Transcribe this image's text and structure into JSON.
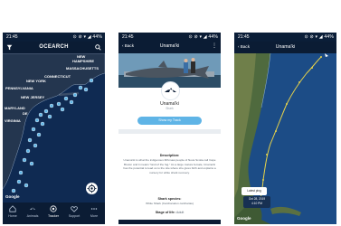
{
  "status": {
    "time": "21:45",
    "right": "⊙ ⊘ ▾ ◢ 44%"
  },
  "phone1": {
    "logo": "OCEARCH",
    "labels": [
      "NEW",
      "HAMPSHIRE",
      "MASSACHUSETTS",
      "CONNECTICUT",
      "NEW YORK",
      "PENNSYLVANIA",
      "NEW JERSEY",
      "MARYLAND",
      "VIRGINIA",
      "DE"
    ],
    "tabs": [
      {
        "label": "Home",
        "icon": "home-icon"
      },
      {
        "label": "Animals",
        "icon": "shark-icon"
      },
      {
        "label": "Tracker",
        "icon": "tracker-icon"
      },
      {
        "label": "Support",
        "icon": "support-icon"
      },
      {
        "label": "More",
        "icon": "more-icon"
      }
    ],
    "active_tab": "Tracker"
  },
  "phone2": {
    "back": "‹ Back",
    "title": "Unama'ki",
    "shark_name": "Unama'ki",
    "shark_sub": "Shark",
    "track_button": "Show my Track",
    "description_title": "Description:",
    "description": "Unama'ki is what the indigenous Mi'kmaw people of Nova Scotia call Cape Breton and it means \"land of the fog.\" As a large mature female, Unama'ki has the potential to lead us to the site where she gives birth and explains a nursery for white shark recovery.",
    "species_title": "Shark species:",
    "species": "White Shark (Carcharodon carcharias)",
    "stage_title": "Stage of life:",
    "stage": "Adult"
  },
  "phone3": {
    "back": "‹ Back",
    "title": "Unama'ki",
    "popup_title": "Latest ping",
    "popup_date": "Oct 28, 2019",
    "popup_time": "4:10 PM",
    "brand": "Google"
  },
  "phone1_brand": "Google",
  "colors": {
    "navy": "#0b1c34",
    "ocean": "#0f2a52",
    "accent": "#5fb4e6",
    "track": "#e8d34a"
  }
}
